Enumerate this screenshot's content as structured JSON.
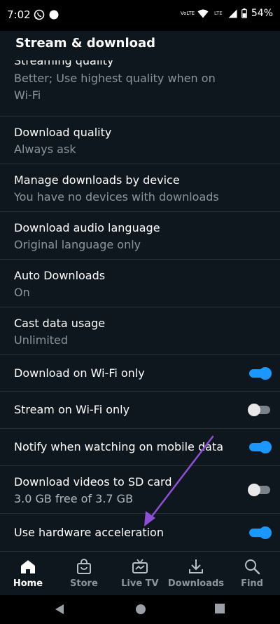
{
  "status_bar": {
    "time": "7:02",
    "battery": "54%",
    "volte": "VoLTE",
    "lte": "LTE"
  },
  "header": {
    "title": "Stream & download"
  },
  "settings": [
    {
      "title": "Streaming quality",
      "subtitle_lines": [
        "Better; Use highest quality when on",
        "Wi-Fi"
      ]
    },
    {
      "title": "Download quality",
      "subtitle": "Always ask"
    },
    {
      "title": "Manage downloads by device",
      "subtitle": "You have no devices with downloads"
    },
    {
      "title": "Download audio language",
      "subtitle": "Original language only"
    },
    {
      "title": "Auto Downloads",
      "subtitle": "On"
    },
    {
      "title": "Cast data usage",
      "subtitle": "Unlimited"
    },
    {
      "title": "Download on Wi-Fi only",
      "toggle": true
    },
    {
      "title": "Stream on Wi-Fi only",
      "toggle": false
    },
    {
      "title": "Notify when watching on mobile data",
      "toggle": true
    },
    {
      "title": "Download videos to SD card",
      "subtitle": "3.0 GB free of 3.7 GB",
      "toggle": false
    },
    {
      "title": "Use hardware acceleration",
      "toggle": true
    }
  ],
  "bottom_nav": [
    {
      "label": "Home",
      "icon": "home-icon",
      "active": true
    },
    {
      "label": "Store",
      "icon": "store-bag-icon",
      "active": false
    },
    {
      "label": "Live TV",
      "icon": "live-tv-icon",
      "active": false
    },
    {
      "label": "Downloads",
      "icon": "download-icon",
      "active": false
    },
    {
      "label": "Find",
      "icon": "search-icon",
      "active": false
    }
  ],
  "colors": {
    "background": "#0f171e",
    "accent": "#1a98ff",
    "annotation_arrow": "#8e4fd6"
  }
}
